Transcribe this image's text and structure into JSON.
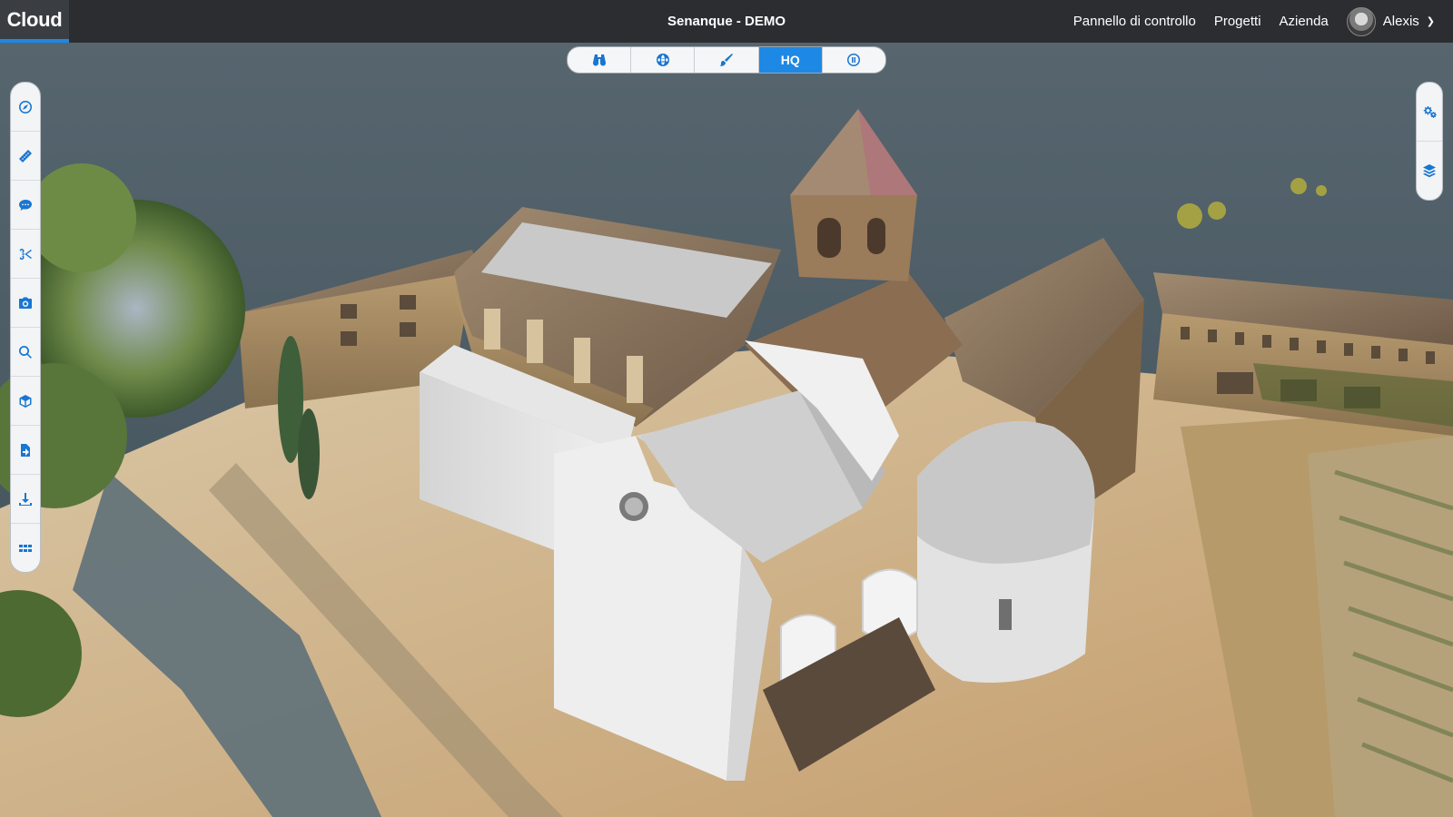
{
  "app": {
    "brand": "Cloud",
    "project_title": "Senanque - DEMO"
  },
  "nav": {
    "items": [
      {
        "label": "Pannello di controllo"
      },
      {
        "label": "Progetti"
      },
      {
        "label": "Azienda"
      }
    ],
    "user_name": "Alexis"
  },
  "view_toolbar": {
    "buttons": [
      {
        "icon": "binoculars-icon"
      },
      {
        "icon": "globe-icon"
      },
      {
        "icon": "brush-icon"
      },
      {
        "label": "HQ",
        "active": true
      },
      {
        "icon": "pause-icon"
      }
    ]
  },
  "left_toolbar": {
    "tools": [
      {
        "icon": "compass-icon"
      },
      {
        "icon": "ruler-icon"
      },
      {
        "icon": "comment-icon"
      },
      {
        "icon": "scissors-icon"
      },
      {
        "icon": "camera-icon"
      },
      {
        "icon": "search-icon"
      },
      {
        "icon": "cube-icon"
      },
      {
        "icon": "file-import-icon"
      },
      {
        "icon": "download-icon"
      },
      {
        "icon": "grid-icon"
      }
    ]
  },
  "right_toolbar": {
    "tools": [
      {
        "icon": "settings-gears-icon"
      },
      {
        "icon": "layers-icon"
      }
    ]
  },
  "colors": {
    "accent": "#1e88e5",
    "topbar": "#2b2d30",
    "sky": "#4f5f69"
  }
}
